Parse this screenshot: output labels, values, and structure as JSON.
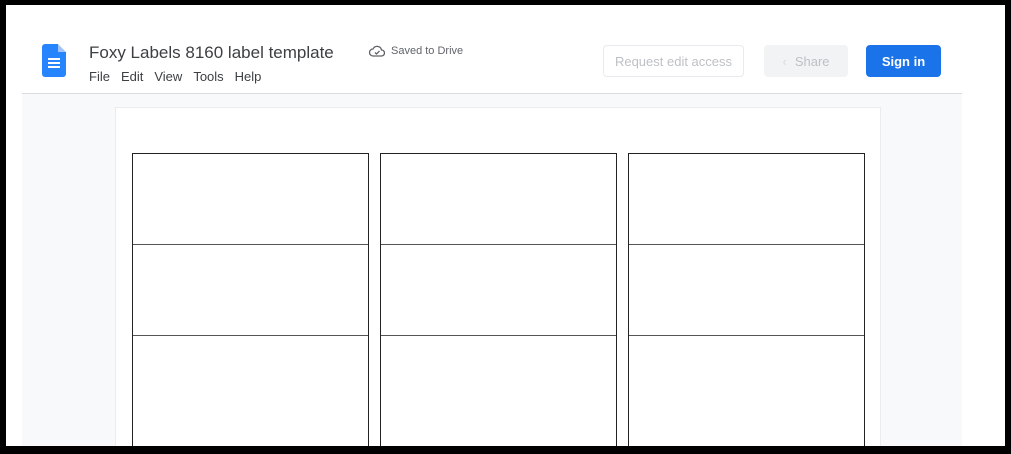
{
  "doc": {
    "title": "Foxy Labels 8160 label template",
    "save_status": "Saved to Drive",
    "icon": "docs-icon",
    "brand_color": "#2684fc"
  },
  "menu": [
    "File",
    "Edit",
    "View",
    "Tools",
    "Help"
  ],
  "actions": {
    "request_edit": "Request edit access",
    "share": "Share",
    "sign_in": "Sign in",
    "sign_in_color": "#1a73e8"
  },
  "labels": {
    "columns": 3,
    "visible_rows": 3
  }
}
